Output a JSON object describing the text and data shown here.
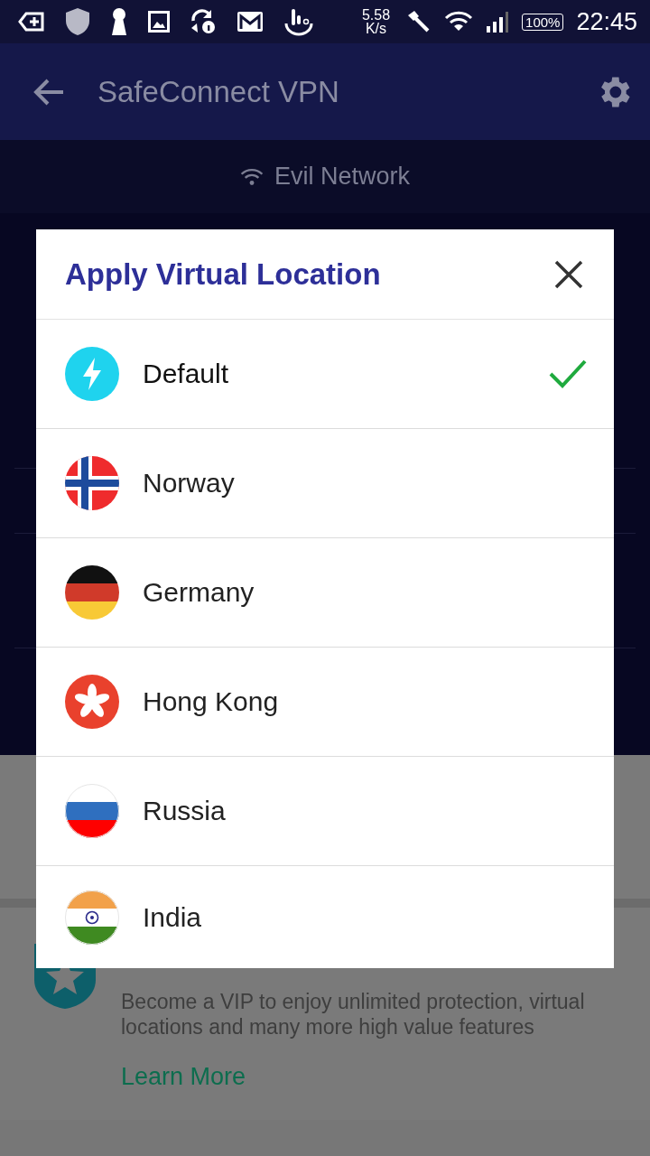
{
  "status_bar": {
    "speed": "5.58",
    "speed_unit": "K/s",
    "battery": "100%",
    "time": "22:45"
  },
  "app_bar": {
    "title": "SafeConnect VPN"
  },
  "network": {
    "name": "Evil Network"
  },
  "promo": {
    "description": "Become a VIP to enjoy unlimited protection, virtual locations and many more high value features",
    "link": "Learn More"
  },
  "dialog": {
    "title": "Apply Virtual Location",
    "locations": [
      {
        "name": "Default",
        "kind": "default",
        "selected": true
      },
      {
        "name": "Norway",
        "kind": "norway",
        "selected": false
      },
      {
        "name": "Germany",
        "kind": "germany",
        "selected": false
      },
      {
        "name": "Hong Kong",
        "kind": "hongkong",
        "selected": false
      },
      {
        "name": "Russia",
        "kind": "russia",
        "selected": false
      },
      {
        "name": "India",
        "kind": "india",
        "selected": false
      }
    ]
  }
}
